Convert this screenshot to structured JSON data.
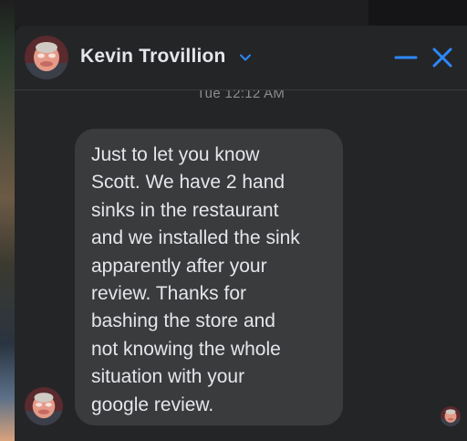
{
  "chat": {
    "contact_name": "Kevin Trovillion",
    "timestamp": "Tue 12:12 AM",
    "message": "Just to let you know\nScott. We have 2 hand\nsinks in the restaurant\nand we installed the sink\napparently after your\nreview. Thanks for\nbashing the store and\nnot knowing the whole\nsituation with your\ngoogle review."
  },
  "icons": {
    "chevron": "chevron-down-icon",
    "minimize": "minimize-icon",
    "close": "close-icon"
  },
  "colors": {
    "accent": "#2d88ff",
    "window_bg": "#242526",
    "bubble_bg": "#3a3b3c",
    "text": "#e4e6eb",
    "muted_text": "#8a8d91"
  }
}
